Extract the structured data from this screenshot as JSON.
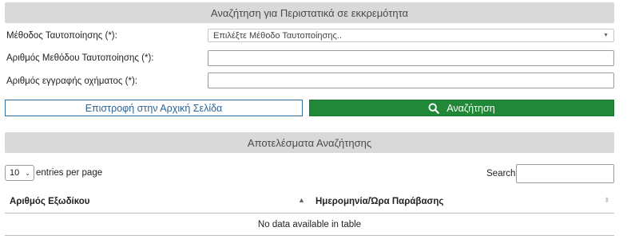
{
  "search_panel": {
    "title": "Αναζήτηση για Περιστατικά σε εκκρεμότητα",
    "fields": [
      {
        "label": "Μέθοδος Ταυτοποίησης (*):",
        "value": "Επιλέξτε Μέθοδο Ταυτοποίησης.."
      },
      {
        "label": "Αριθμός Μεθόδου Ταυτοποίησης (*):",
        "value": ""
      },
      {
        "label": "Αριθμός εγγραφής οχήματος (*):",
        "value": ""
      }
    ],
    "home_button": "Επιστροφή στην Αρχική Σελίδα",
    "search_button": "Αναζήτηση"
  },
  "results_panel": {
    "title": "Αποτελέσματα Αναζήτησης",
    "page_length": "10",
    "entries_label": "entries per page",
    "search_label": "Search:",
    "search_value": "",
    "columns": [
      "Αριθμός Εξωδίκου",
      "Ημερομηνία/Ώρα Παράβασης"
    ],
    "empty_message": "No data available in table"
  },
  "colors": {
    "header_bg": "#d9d9d9",
    "search_button": "#218838",
    "home_button_border": "#2f6f9f"
  },
  "icons": {
    "search_button": "search-icon",
    "select_caret": "chevron-down-icon",
    "sort_asc": "sort-ascending-icon",
    "sort_both": "sort-both-icon"
  }
}
